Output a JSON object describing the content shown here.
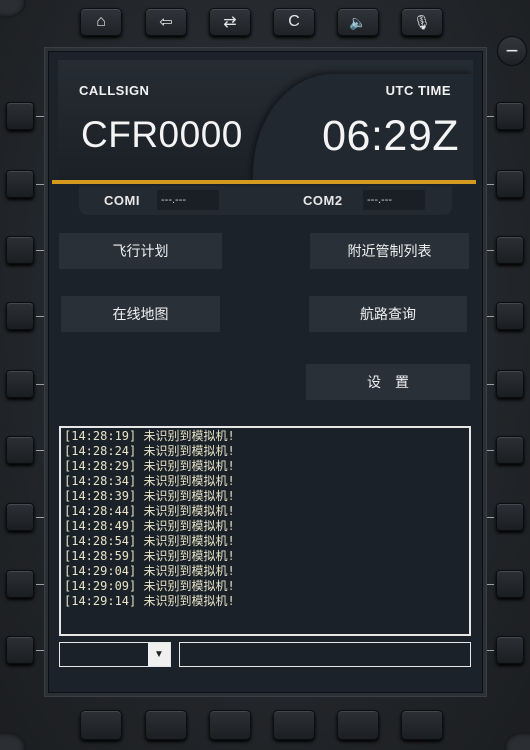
{
  "header": {
    "callsign_label": "CALLSIGN",
    "callsign_value": "CFR0000",
    "utc_label": "UTC TIME",
    "utc_value": "06:29Z"
  },
  "com": {
    "com1_label": "COMI",
    "com1_value": "---.---",
    "com2_label": "COM2",
    "com2_value": "---.---"
  },
  "menu": {
    "flight_plan": "飞行计划",
    "nearby_atc": "附近管制列表",
    "online_map": "在线地图",
    "route_query": "航路查询",
    "settings": "设　置"
  },
  "log": [
    "[14:28:19] 未识别到模拟机!",
    "[14:28:24] 未识别到模拟机!",
    "[14:28:29] 未识别到模拟机!",
    "[14:28:34] 未识别到模拟机!",
    "[14:28:39] 未识别到模拟机!",
    "[14:28:44] 未识别到模拟机!",
    "[14:28:49] 未识别到模拟机!",
    "[14:28:54] 未识别到模拟机!",
    "[14:28:59] 未识别到模拟机!",
    "[14:29:04] 未识别到模拟机!",
    "[14:29:09] 未识别到模拟机!",
    "[14:29:14] 未识别到模拟机!"
  ],
  "top_buttons": {
    "home": "⌂",
    "back": "⇦",
    "swap": "⇄",
    "clear": "C",
    "volume": "🔈",
    "mic": "🎙"
  },
  "minus_knob": "−",
  "select": {
    "value": ""
  },
  "input": {
    "value": ""
  },
  "colors": {
    "accent_line": "#d49a1d",
    "screen_bg": "#1c2229"
  }
}
